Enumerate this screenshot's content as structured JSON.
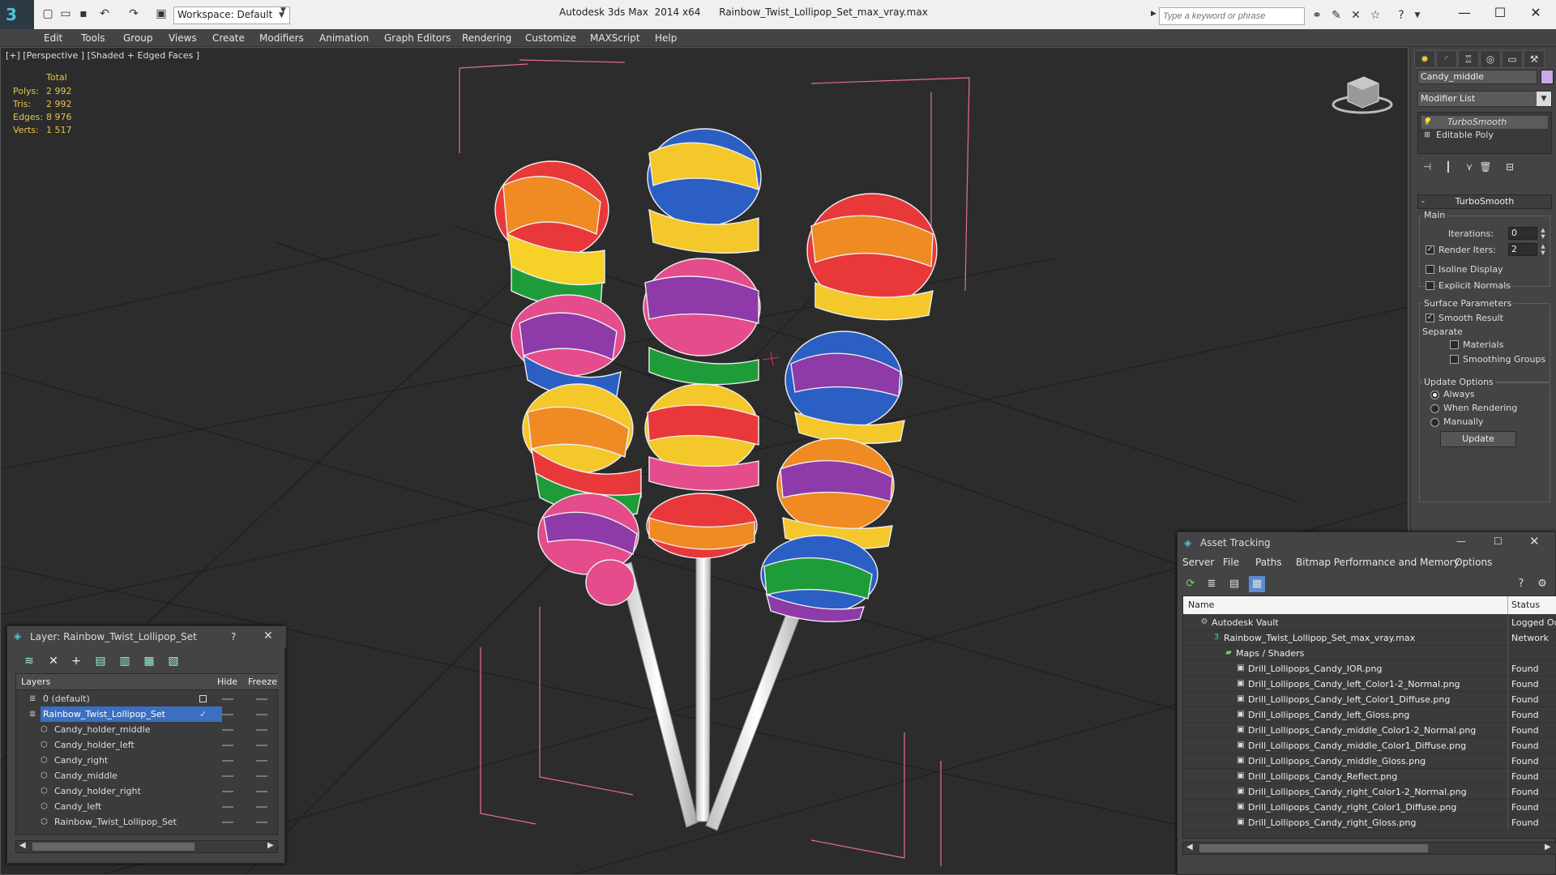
{
  "app": {
    "title": "Autodesk 3ds Max  2014 x64      Rainbow_Twist_Lollipop_Set_max_vray.max",
    "workspace": "Workspace: Default",
    "search_placeholder": "Type a keyword or phrase",
    "accent_color": "#4fc3d8"
  },
  "menu": [
    "Edit",
    "Tools",
    "Group",
    "Views",
    "Create",
    "Modifiers",
    "Animation",
    "Graph Editors",
    "Rendering",
    "Customize",
    "MAXScript",
    "Help"
  ],
  "viewport": {
    "label": "[+] [Perspective ] [Shaded + Edged Faces ]",
    "stats": {
      "header": "Total",
      "rows": [
        {
          "label": "Polys:",
          "value": "2 992"
        },
        {
          "label": "Tris:",
          "value": "2 992"
        },
        {
          "label": "Edges:",
          "value": "8 976"
        },
        {
          "label": "Verts:",
          "value": "1 517"
        }
      ]
    }
  },
  "command_panel": {
    "object_name": "Candy_middle",
    "object_color": "#c9a9e8",
    "modifier_list": "Modifier List",
    "stack": [
      "TurboSmooth",
      "Editable Poly"
    ],
    "rollout_title": "TurboSmooth",
    "main_group": "Main",
    "iterations_label": "Iterations:",
    "iterations_value": "0",
    "render_iters_label": "Render Iters:",
    "render_iters_value": "2",
    "render_iters_checked": true,
    "isoline_label": "Isoline Display",
    "explicit_normals_label": "Explicit Normals",
    "surface_group": "Surface Parameters",
    "smooth_result_label": "Smooth Result",
    "separate_label": "Separate",
    "materials_label": "Materials",
    "smoothing_groups_label": "Smoothing Groups",
    "update_group": "Update Options",
    "always_label": "Always",
    "when_rendering_label": "When Rendering",
    "manually_label": "Manually",
    "update_button": "Update"
  },
  "layer_dialog": {
    "title": "Layer: Rainbow_Twist_Lollipop_Set",
    "help": "?",
    "col_layers": "Layers",
    "col_hide": "Hide",
    "col_freeze": "Freeze",
    "rows": [
      {
        "name": "0 (default)",
        "level": 0,
        "selected": false
      },
      {
        "name": "Rainbow_Twist_Lollipop_Set",
        "level": 0,
        "selected": true
      },
      {
        "name": "Candy_holder_middle",
        "level": 1,
        "selected": false
      },
      {
        "name": "Candy_holder_left",
        "level": 1,
        "selected": false
      },
      {
        "name": "Candy_right",
        "level": 1,
        "selected": false
      },
      {
        "name": "Candy_middle",
        "level": 1,
        "selected": false
      },
      {
        "name": "Candy_holder_right",
        "level": 1,
        "selected": false
      },
      {
        "name": "Candy_left",
        "level": 1,
        "selected": false
      },
      {
        "name": "Rainbow_Twist_Lollipop_Set",
        "level": 1,
        "selected": false
      }
    ]
  },
  "asset_tracking": {
    "title": "Asset Tracking",
    "menu": [
      "Server",
      "File",
      "Paths",
      "Bitmap Performance and Memory",
      "Options"
    ],
    "col_name": "Name",
    "col_status": "Status",
    "rows": [
      {
        "name": "Autodesk Vault",
        "status": "Logged Out",
        "level": 0,
        "icon": "vault-icon"
      },
      {
        "name": "Rainbow_Twist_Lollipop_Set_max_vray.max",
        "status": "Network",
        "level": 1,
        "icon": "max-file-icon"
      },
      {
        "name": "Maps / Shaders",
        "status": "",
        "level": 2,
        "icon": "folder-icon"
      },
      {
        "name": "Drill_Lollipops_Candy_IOR.png",
        "status": "Found",
        "level": 3,
        "icon": "bitmap-icon"
      },
      {
        "name": "Drill_Lollipops_Candy_left_Color1-2_Normal.png",
        "status": "Found",
        "level": 3,
        "icon": "bitmap-icon"
      },
      {
        "name": "Drill_Lollipops_Candy_left_Color1_Diffuse.png",
        "status": "Found",
        "level": 3,
        "icon": "bitmap-icon"
      },
      {
        "name": "Drill_Lollipops_Candy_left_Gloss.png",
        "status": "Found",
        "level": 3,
        "icon": "bitmap-icon"
      },
      {
        "name": "Drill_Lollipops_Candy_middle_Color1-2_Normal.png",
        "status": "Found",
        "level": 3,
        "icon": "bitmap-icon"
      },
      {
        "name": "Drill_Lollipops_Candy_middle_Color1_Diffuse.png",
        "status": "Found",
        "level": 3,
        "icon": "bitmap-icon"
      },
      {
        "name": "Drill_Lollipops_Candy_middle_Gloss.png",
        "status": "Found",
        "level": 3,
        "icon": "bitmap-icon"
      },
      {
        "name": "Drill_Lollipops_Candy_Reflect.png",
        "status": "Found",
        "level": 3,
        "icon": "bitmap-icon"
      },
      {
        "name": "Drill_Lollipops_Candy_right_Color1-2_Normal.png",
        "status": "Found",
        "level": 3,
        "icon": "bitmap-icon"
      },
      {
        "name": "Drill_Lollipops_Candy_right_Color1_Diffuse.png",
        "status": "Found",
        "level": 3,
        "icon": "bitmap-icon"
      },
      {
        "name": "Drill_Lollipops_Candy_right_Gloss.png",
        "status": "Found",
        "level": 3,
        "icon": "bitmap-icon"
      }
    ]
  }
}
